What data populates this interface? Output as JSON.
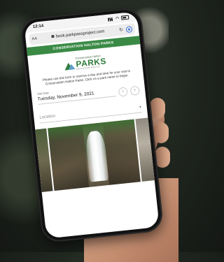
{
  "status_bar": {
    "time": "12:14"
  },
  "browser": {
    "text_size_label": "AA",
    "url": "book.parkpassproject.com"
  },
  "site": {
    "banner": "CONSERVATION HALTON PARKS",
    "logo": {
      "top_text": "Conservation Halton",
      "main_text": "PARKS",
      "tagline": "MOUNTAIN ROUTE"
    },
    "intro": "Please use this form to reserve a day and time for your visit to Conservation Halton Parks. Click on a park name to begin.",
    "visit_date": {
      "label": "Visit Date",
      "value": "Tuesday, November 9, 2021",
      "prev": "‹",
      "next": "›"
    },
    "location": {
      "placeholder": "Location",
      "caret": "▾"
    }
  },
  "colors": {
    "brand_green": "#3a8a46",
    "accent_blue": "#3a6fd8"
  },
  "icons": [
    "lock-icon",
    "reload-icon",
    "compass-icon",
    "signal-icon",
    "wifi-icon",
    "battery-icon",
    "chevron-left-icon",
    "chevron-right-icon",
    "dropdown-caret-icon"
  ]
}
